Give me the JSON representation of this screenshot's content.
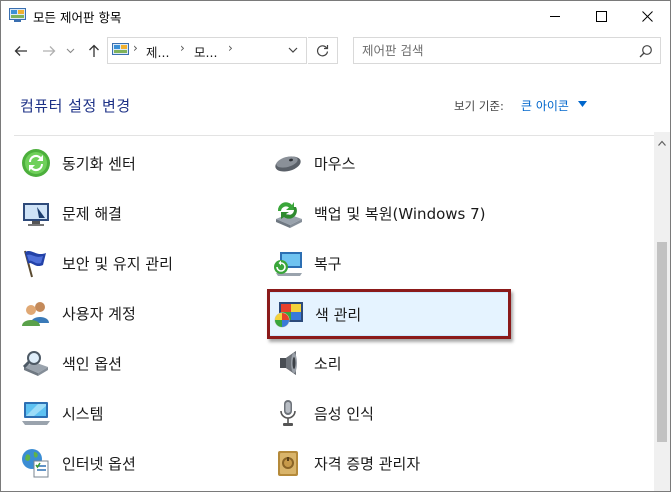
{
  "window": {
    "title": "모든 제어판 항목"
  },
  "navigation": {
    "breadcrumbs": [
      "제...",
      "모..."
    ],
    "search_placeholder": "제어판 검색"
  },
  "header": {
    "title": "컴퓨터 설정 변경",
    "view_by_label": "보기 기준:",
    "view_by_value": "큰 아이콘"
  },
  "items_left": [
    {
      "label": "동기화 센터",
      "icon": "sync-center-icon"
    },
    {
      "label": "문제 해결",
      "icon": "troubleshooting-icon"
    },
    {
      "label": "보안 및 유지 관리",
      "icon": "security-flag-icon"
    },
    {
      "label": "사용자 계정",
      "icon": "user-accounts-icon"
    },
    {
      "label": "색인 옵션",
      "icon": "indexing-options-icon"
    },
    {
      "label": "시스템",
      "icon": "system-icon"
    },
    {
      "label": "인터넷 옵션",
      "icon": "internet-options-icon"
    }
  ],
  "items_right": [
    {
      "label": "마우스",
      "icon": "mouse-icon"
    },
    {
      "label": "백업 및 복원(Windows 7)",
      "icon": "backup-restore-icon"
    },
    {
      "label": "복구",
      "icon": "recovery-icon"
    },
    {
      "label": "색 관리",
      "icon": "color-management-icon",
      "selected": true
    },
    {
      "label": "소리",
      "icon": "sound-icon"
    },
    {
      "label": "음성 인식",
      "icon": "speech-recognition-icon"
    },
    {
      "label": "자격 증명 관리자",
      "icon": "credential-manager-icon"
    }
  ],
  "colors": {
    "heading": "#1e3287",
    "link": "#0066cc",
    "selection_bg": "#e5f3ff",
    "highlight_frame": "#8b1a1a"
  }
}
